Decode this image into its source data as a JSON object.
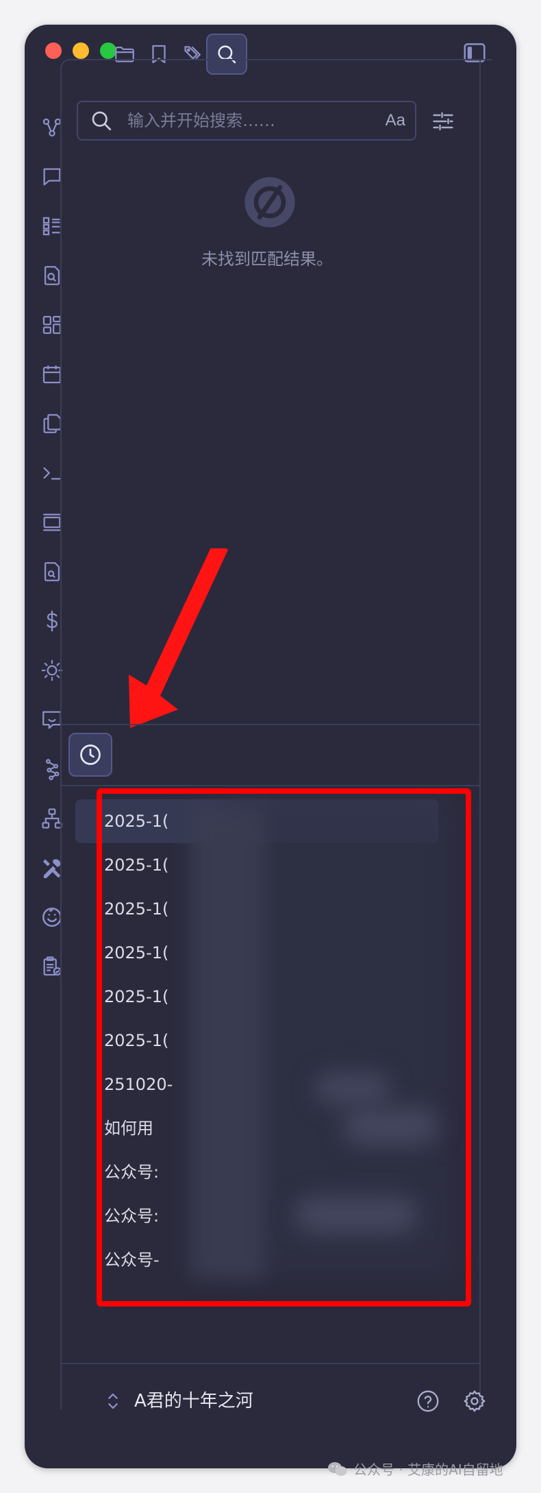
{
  "colors": {
    "window_bg": "#2a2a3c",
    "icon": "#8d90c8",
    "accent_active": "#3a3d5e",
    "highlight_red": "#ff0000",
    "text": "#dcdde8"
  },
  "titlebar": {
    "tabs": [
      {
        "icon": "folder-icon",
        "active": false
      },
      {
        "icon": "bookmark-icon",
        "active": false
      },
      {
        "icon": "tags-icon",
        "active": false
      },
      {
        "icon": "search-icon",
        "active": true
      }
    ],
    "right_icon": "sidebar-toggle-icon"
  },
  "ribbon": {
    "icons": [
      "graph-icon",
      "chat-icon",
      "list-icon",
      "file-search-icon",
      "grid-icon",
      "calendar-icon",
      "copy-icon",
      "terminal-icon",
      "slides-icon",
      "file-search-2-icon",
      "dollar-icon",
      "sun-icon",
      "message-smile-icon",
      "network-icon",
      "sitemap-icon",
      "tools-icon",
      "smile-icon",
      "clipboard-check-icon"
    ]
  },
  "search": {
    "placeholder": "输入并开始搜索……",
    "value": "",
    "match_case_label": "Aa",
    "empty_message": "未找到匹配结果。"
  },
  "recent": {
    "items": [
      {
        "label": "2025-1("
      },
      {
        "label": "2025-1("
      },
      {
        "label": "2025-1("
      },
      {
        "label": "2025-1("
      },
      {
        "label": "2025-1("
      },
      {
        "label": "2025-1("
      },
      {
        "label": "251020-"
      },
      {
        "label": "如何用"
      },
      {
        "label": "公众号:"
      },
      {
        "label": "公众号:"
      },
      {
        "label": "公众号-"
      }
    ]
  },
  "footer": {
    "vault_name": "A君的十年之河"
  },
  "watermark": {
    "text": "公众号 · 艾康的AI自留地"
  }
}
